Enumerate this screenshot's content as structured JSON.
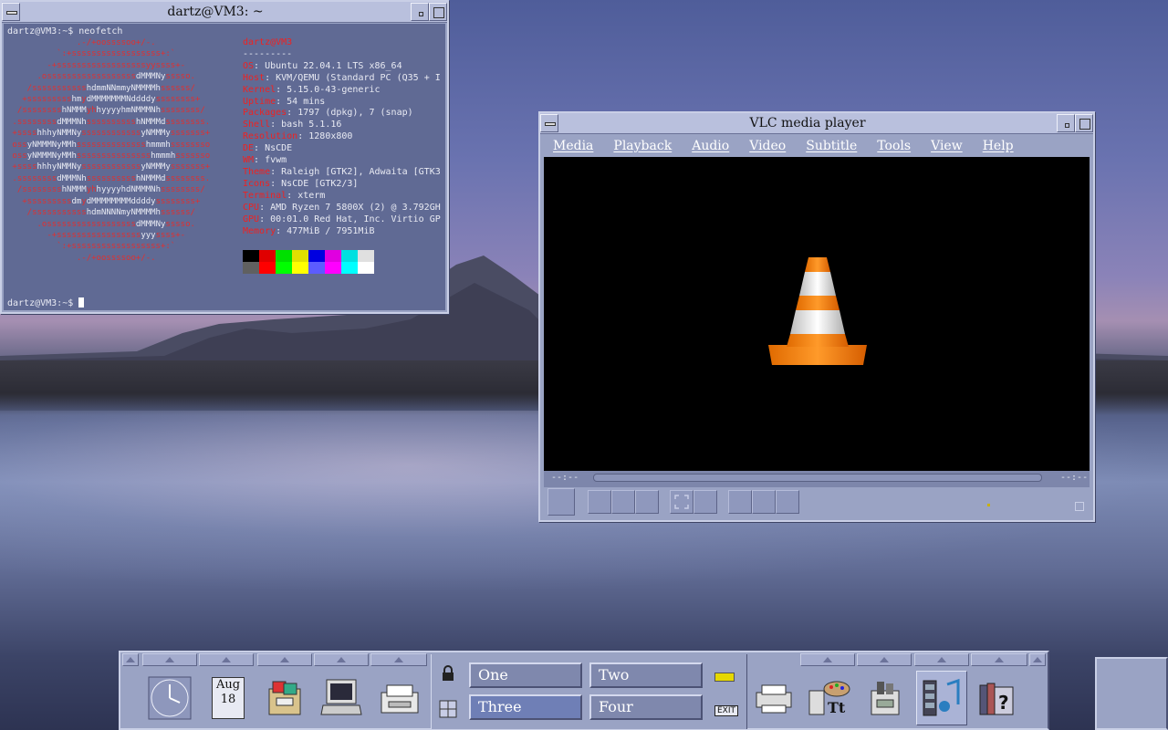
{
  "terminal": {
    "title": "dartz@VM3: ~",
    "prompt_cmd": "dartz@VM3:~$ neofetch",
    "prompt_end": "dartz@VM3:~$ ",
    "user_host": "dartz@VM3",
    "separator": "---------",
    "info": [
      {
        "key": "OS",
        "value": ": Ubuntu 22.04.1 LTS x86_64"
      },
      {
        "key": "Host",
        "value": ": KVM/QEMU (Standard PC (Q35 + I"
      },
      {
        "key": "Kernel",
        "value": ": 5.15.0-43-generic"
      },
      {
        "key": "Uptime",
        "value": ": 54 mins"
      },
      {
        "key": "Packages",
        "value": ": 1797 (dpkg), 7 (snap)"
      },
      {
        "key": "Shell",
        "value": ": bash 5.1.16"
      },
      {
        "key": "Resolution",
        "value": ": 1280x800"
      },
      {
        "key": "DE",
        "value": ": NsCDE"
      },
      {
        "key": "WM",
        "value": ": fvwm"
      },
      {
        "key": "Theme",
        "value": ": Raleigh [GTK2], Adwaita [GTK3"
      },
      {
        "key": "Icons",
        "value": ": NsCDE [GTK2/3]"
      },
      {
        "key": "Terminal",
        "value": ": xterm"
      },
      {
        "key": "CPU",
        "value": ": AMD Ryzen 7 5800X (2) @ 3.792GH"
      },
      {
        "key": "GPU",
        "value": ": 00:01.0 Red Hat, Inc. Virtio GP"
      },
      {
        "key": "Memory",
        "value": ": 477MiB / 7951MiB"
      }
    ],
    "palette": [
      "#000000",
      "#e00000",
      "#00e000",
      "#e0e000",
      "#0000e0",
      "#e000e0",
      "#00e0e0",
      "#e0e0e0",
      "#606060",
      "#ff0000",
      "#00ff00",
      "#ffff00",
      "#5c5cff",
      "#ff00ff",
      "#00ffff",
      "#ffffff"
    ]
  },
  "vlc": {
    "title": "VLC media player",
    "menu": [
      "Media",
      "Playback",
      "Audio",
      "Video",
      "Subtitle",
      "Tools",
      "View",
      "Help"
    ],
    "time_elapsed": "--:--",
    "time_total": "--:--"
  },
  "panel": {
    "calendar_month": "Aug",
    "calendar_day": "18",
    "workspaces": [
      "One",
      "Two",
      "Three",
      "Four"
    ],
    "exit_label": "EXIT"
  }
}
